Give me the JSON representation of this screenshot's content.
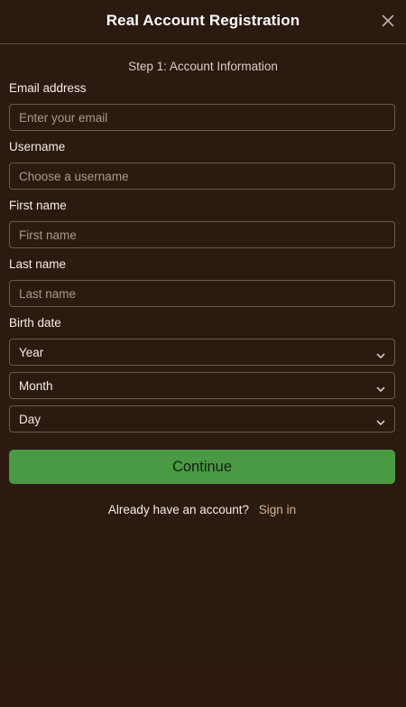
{
  "header": {
    "title": "Real Account Registration",
    "close_icon": "close-icon"
  },
  "step": {
    "text": "Step 1: Account Information"
  },
  "form": {
    "email": {
      "label": "Email address",
      "placeholder": "Enter your email",
      "value": ""
    },
    "username": {
      "label": "Username",
      "placeholder": "Choose a username",
      "value": ""
    },
    "first_name": {
      "label": "First name",
      "placeholder": "First name",
      "value": ""
    },
    "last_name": {
      "label": "Last name",
      "placeholder": "Last name",
      "value": ""
    },
    "birth_date": {
      "label": "Birth date",
      "year": "Year",
      "month": "Month",
      "day": "Day"
    }
  },
  "actions": {
    "continue_label": "Continue",
    "signin_prompt": "Already have an account?",
    "signin_link": "Sign in"
  },
  "colors": {
    "background": "#2c1a10",
    "accent_green": "#4a9a43",
    "link": "#d9b490",
    "border": "#6a5a50"
  }
}
